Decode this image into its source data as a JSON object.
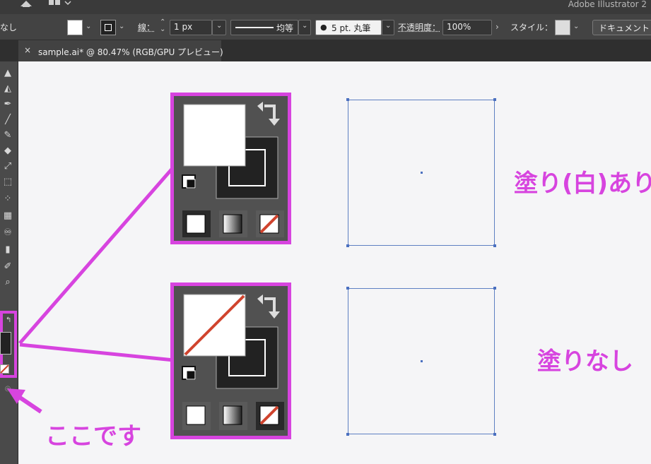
{
  "app": {
    "title": "Adobe Illustrator 2"
  },
  "controlbar": {
    "left_label": "なし",
    "stroke_label": "線：",
    "stroke_width": "1 px",
    "brush_uniform": "均等",
    "brush_round": "5 pt. 丸筆",
    "opacity_label": "不透明度：",
    "opacity_value": "100%",
    "style_label": "スタイル：",
    "document_button": "ドキュメント"
  },
  "tab": {
    "close": "×",
    "title": "sample.ai* @ 80.47% (RGB/GPU プレビュー)"
  },
  "annotations": {
    "fill_white": "塗り(白)あり",
    "fill_none": "塗りなし",
    "here": "ここです"
  },
  "colors": {
    "accent": "#d744df",
    "artboard_border": "#5d7fc2",
    "none_slash": "#d0442e"
  },
  "icons": [
    "home-icon",
    "workspace-icon",
    "swap-icon",
    "default-colors-icon",
    "fill-none-icon"
  ]
}
